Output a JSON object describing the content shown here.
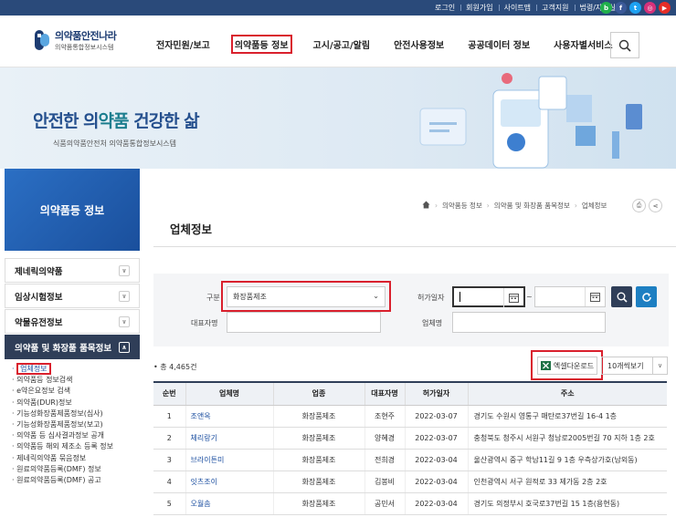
{
  "utility_links": [
    "로그인",
    "회원가입",
    "사이트맵",
    "고객지원",
    "법령/자료실"
  ],
  "sns": [
    {
      "name": "blog",
      "glyph": "b",
      "color": "#20b04b"
    },
    {
      "name": "facebook",
      "glyph": "f",
      "color": "#3b5998"
    },
    {
      "name": "twitter",
      "glyph": "t",
      "color": "#1da1f2"
    },
    {
      "name": "instagram",
      "glyph": "◎",
      "color": "#d6317a"
    },
    {
      "name": "youtube",
      "glyph": "▶",
      "color": "#e52d27"
    }
  ],
  "logo": {
    "title": "의약품안전나라",
    "subtitle": "의약품통합정보시스템"
  },
  "gnb": [
    "전자민원/보고",
    "의약품등 정보",
    "고시/공고/알림",
    "안전사용정보",
    "공공데이터 정보",
    "사용자별서비스"
  ],
  "gnb_active_index": 1,
  "hero": {
    "title_part1": "안전한 의",
    "title_part2": "약품",
    "title_part3": " 건강한 삶",
    "subtitle": "식품의약품안전처 의약품통합정보시스템"
  },
  "lnb": {
    "heading": "의약품등 정보",
    "items": [
      "제네릭의약품",
      "임상시험정보",
      "약물유전정보",
      "의약품 및 화장품 품목정보"
    ],
    "sub_items": [
      "업체정보",
      "의약품등 정보검색",
      "e약은요정보 검색",
      "의약품(DUR)정보",
      "기능성화장품제품정보(심사)",
      "기능성화장품제품정보(보고)",
      "의약품 등 심사결과정보 공개",
      "의약품등 해외 제조소 등록 정보",
      "제네릭의약품 묶음정보",
      "원료의약품등록(DMF) 정보",
      "원료의약품등록(DMF) 공고"
    ]
  },
  "breadcrumb": [
    "의약품등 정보",
    "의약품 및 화장품 품목정보",
    "업체정보"
  ],
  "page_title": "업체정보",
  "search": {
    "category_label": "구분",
    "category_value": "화장품제조",
    "date_label": "허가일자",
    "date_sep": "~",
    "rep_label": "대표자명",
    "company_label": "업체명"
  },
  "total_text": "총 4,465건",
  "excel_label": "엑셀다운로드",
  "page_size": "10개씩보기",
  "table": {
    "headers": [
      "순번",
      "업체명",
      "업종",
      "대표자명",
      "허가일자",
      "주소"
    ],
    "rows": [
      [
        "1",
        "조앤옥",
        "화장품제조",
        "조현주",
        "2022-03-07",
        "경기도 수원시 영통구 매탄로37번길 16-4 1층"
      ],
      [
        "2",
        "체리랑기",
        "화장품제조",
        "양혜경",
        "2022-03-07",
        "충청북도 청주시 서원구 청남로2005번길 70 지하 1층 2호"
      ],
      [
        "3",
        "브라이튼미",
        "화장품제조",
        "전희경",
        "2022-03-04",
        "울산광역시 중구 학남11길 9 1층 우측상가호(남외동)"
      ],
      [
        "4",
        "잇츠조이",
        "화장품제조",
        "김봉비",
        "2022-03-04",
        "인천광역시 서구 원적로 33 제가동 2층 2호"
      ],
      [
        "5",
        "오월솜",
        "화장품제조",
        "공민서",
        "2022-03-04",
        "경기도 의정부시 호국로37번길 15 1층(용현동)"
      ]
    ]
  }
}
